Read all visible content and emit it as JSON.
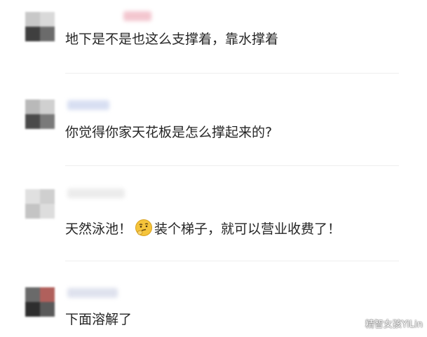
{
  "comments": [
    {
      "text": "地下是不是也这么支撑着，靠水撑着"
    },
    {
      "text": "你觉得你家天花板是怎么撑起来的?"
    },
    {
      "text_before": "天然泳池！",
      "emoji": "thinking-face-emoji",
      "text_after": "装个梯子，就可以营业收费了！"
    },
    {
      "text": "下面溶解了"
    }
  ],
  "watermark": "精智女孩YiLin",
  "colors": {
    "text": "#262626",
    "divider": "#eeeeee",
    "emoji": "#f5c43b"
  }
}
